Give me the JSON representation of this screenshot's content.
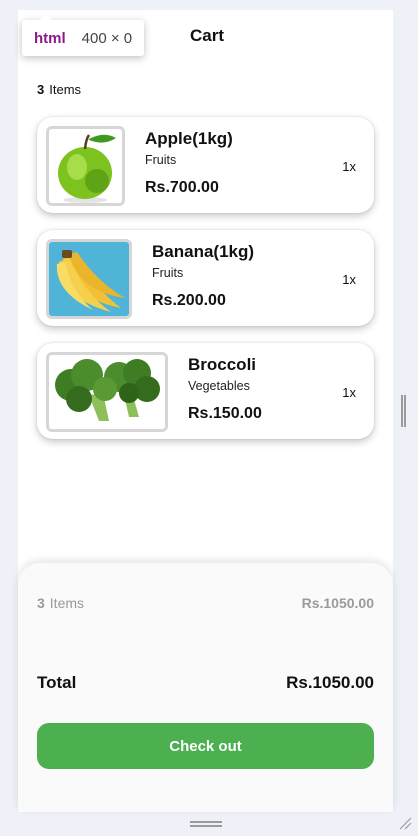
{
  "inspector": {
    "tag": "html",
    "size": "400 × 0"
  },
  "header": {
    "title": "Cart"
  },
  "cart": {
    "count": "3",
    "items_label": "Items"
  },
  "items": [
    {
      "name": "Apple(1kg)",
      "category": "Fruits",
      "price": "Rs.700.00",
      "qty": "1x",
      "image": "apple-image"
    },
    {
      "name": "Banana(1kg)",
      "category": "Fruits",
      "price": "Rs.200.00",
      "qty": "1x",
      "image": "banana-image"
    },
    {
      "name": "Broccoli",
      "category": "Vegetables",
      "price": "Rs.150.00",
      "qty": "1x",
      "image": "broccoli-image"
    }
  ],
  "summary": {
    "count": "3",
    "items_label": "Items",
    "subtotal": "Rs.1050.00",
    "total_label": "Total",
    "total_value": "Rs.1050.00",
    "checkout_label": "Check out"
  },
  "colors": {
    "accent": "#4caf50",
    "inspector_tag": "#8a1a86",
    "background": "#eef1f8"
  }
}
